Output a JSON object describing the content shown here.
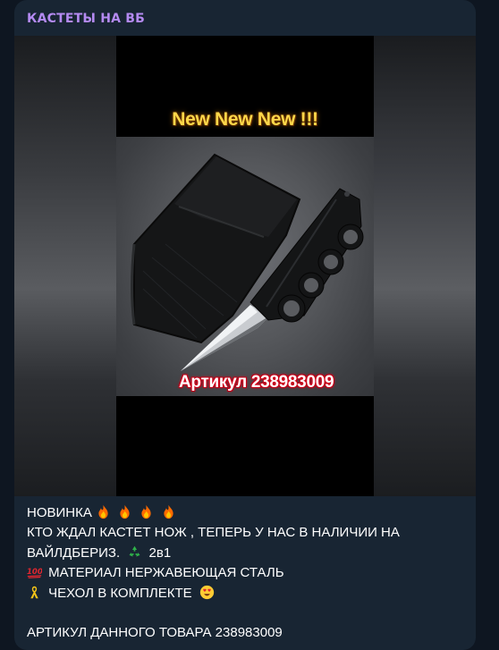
{
  "channel": {
    "name": "КАСТЕТЫ НА ВБ"
  },
  "media": {
    "headline": "New New New !!!",
    "article_label": "Артикул 238983009"
  },
  "caption": {
    "line1_text": "НОВИНКА",
    "line1_icons": [
      "fire-icon",
      "fire-icon",
      "fire-icon",
      "fire-icon"
    ],
    "line2_text": "КТО ЖДАЛ КАСТЕТ НОЖ , ТЕПЕРЬ У НАС В НАЛИЧИИ НА",
    "line3_text": "ВАЙЛДБЕРИЗ.",
    "line3_icon": "recycle-icon",
    "line3_suffix": "2в1",
    "line4_icon": "hundred-points-icon",
    "line4_text": "МАТЕРИАЛ НЕРЖАВЕЮЩАЯ СТАЛЬ",
    "line5_icon": "yellow-ribbon-icon",
    "line5_text": "ЧЕХОЛ В КОМПЛЕКТЕ",
    "line5_end_icon": "heart-eyes-icon",
    "line7_text": "АРТИКУЛ ДАННОГО ТОВАРА 238983009"
  },
  "colors": {
    "background": "#0e1621",
    "bubble": "#182533",
    "channel_name": "#b48af1",
    "headline": "#ffd84a",
    "article_label_outline": "#d8001c",
    "text": "#ffffff"
  }
}
